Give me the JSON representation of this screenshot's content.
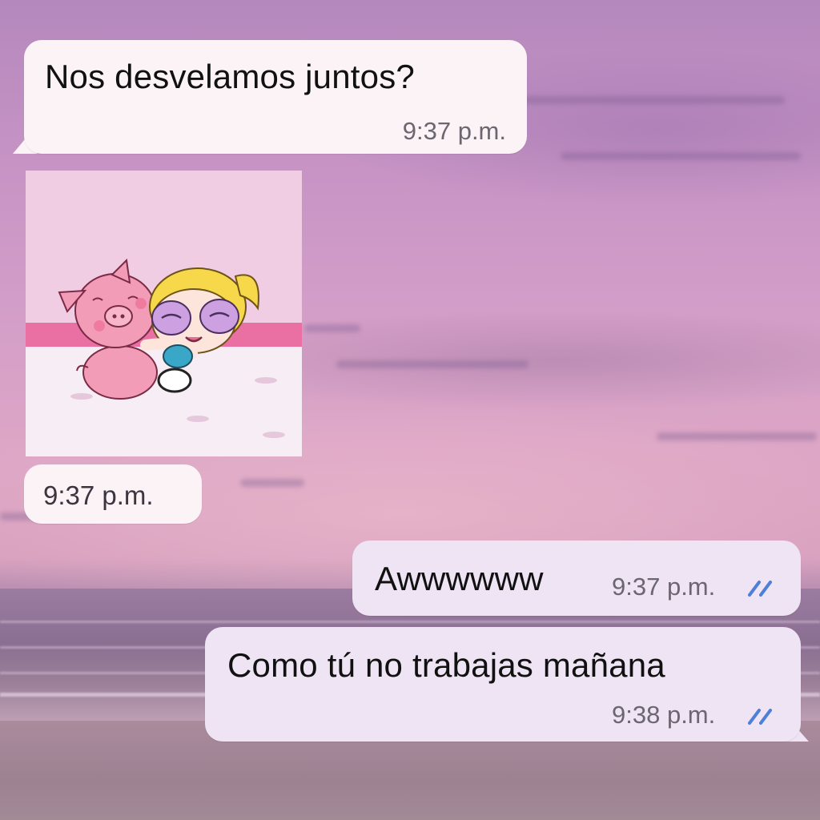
{
  "chat": {
    "messages": [
      {
        "direction": "incoming",
        "type": "text",
        "text": "Nos desvelamos juntos?",
        "time": "9:37 p.m."
      },
      {
        "direction": "incoming",
        "type": "image",
        "image_description": "sticker-piglet-hug",
        "time": "9:37 p.m."
      },
      {
        "direction": "outgoing",
        "type": "text",
        "text": "Awwwwww",
        "time": "9:37 p.m.",
        "status": "read-double-check"
      },
      {
        "direction": "outgoing",
        "type": "text",
        "text": "Como tú no trabajas mañana",
        "time": "9:38 p.m.",
        "status": "read-double-check"
      }
    ]
  },
  "colors": {
    "incoming_bubble": "#fbf3f6",
    "outgoing_bubble": "#eee4f4",
    "read_check": "#4f7fd6",
    "time_text": "#6b6670"
  }
}
